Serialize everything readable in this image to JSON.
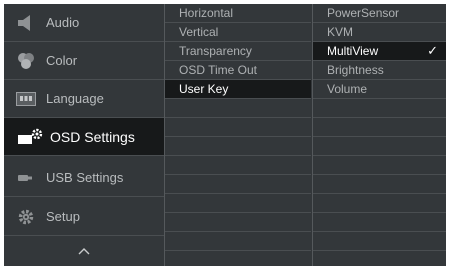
{
  "menu": {
    "items": [
      {
        "label": "Audio",
        "icon": "speaker-icon"
      },
      {
        "label": "Color",
        "icon": "color-circles-icon"
      },
      {
        "label": "Language",
        "icon": "language-icon"
      },
      {
        "label": "OSD Settings",
        "icon": "osd-settings-icon"
      },
      {
        "label": "USB Settings",
        "icon": "usb-icon"
      },
      {
        "label": "Setup",
        "icon": "gear-icon"
      }
    ],
    "up_icon": "chevron-up-icon"
  },
  "submenu": {
    "items": [
      "Horizontal",
      "Vertical",
      "Transparency",
      "OSD Time Out",
      "User Key"
    ]
  },
  "options": {
    "items": [
      "PowerSensor",
      "KVM",
      "MultiView",
      "Brightness",
      "Volume"
    ],
    "check": "✓"
  }
}
